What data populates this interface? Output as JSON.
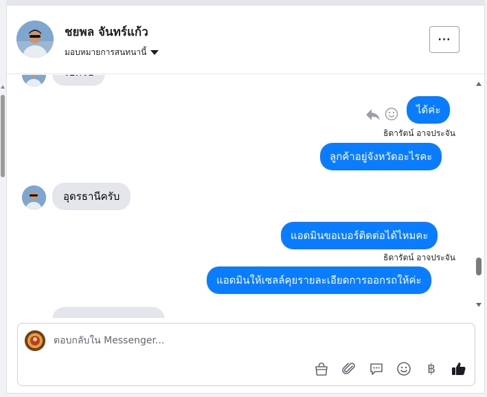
{
  "header": {
    "contact_name": "ชยพล จันทร์แก้ว",
    "assign_label": "มอบหมายการสนทนานี้",
    "more_label": "···"
  },
  "messages": [
    {
      "direction": "in",
      "text": "ไปครับ",
      "partial": true
    },
    {
      "direction": "out",
      "text": "ได้ค่ะ"
    },
    {
      "direction": "out",
      "sender": "ธิดารัตน์ อาจประจัน",
      "text": "ลูกค้าอยู่จังหวัดอะไรคะ"
    },
    {
      "direction": "in",
      "text": "อุดรธานีครับ"
    },
    {
      "direction": "out",
      "text": "แอดมินขอเบอร์ติดต่อได้ไหมคะ"
    },
    {
      "direction": "out",
      "sender": "ธิดารัตน์ อาจประจัน",
      "text": "แอดมินให้เซลล์คุยรายละเอียดการออกรถให้ค่ะ"
    }
  ],
  "composer": {
    "placeholder": "ตอบกลับใน Messenger...",
    "value": "",
    "tools": [
      "shopping-bag-icon",
      "paperclip-icon",
      "saved-reply-icon",
      "emoji-icon",
      "baht-icon",
      "thumbs-up-icon"
    ],
    "baht_symbol": "฿"
  },
  "colors": {
    "outgoing_bubble": "#0a7cff",
    "incoming_bubble": "#e4e6eb"
  }
}
